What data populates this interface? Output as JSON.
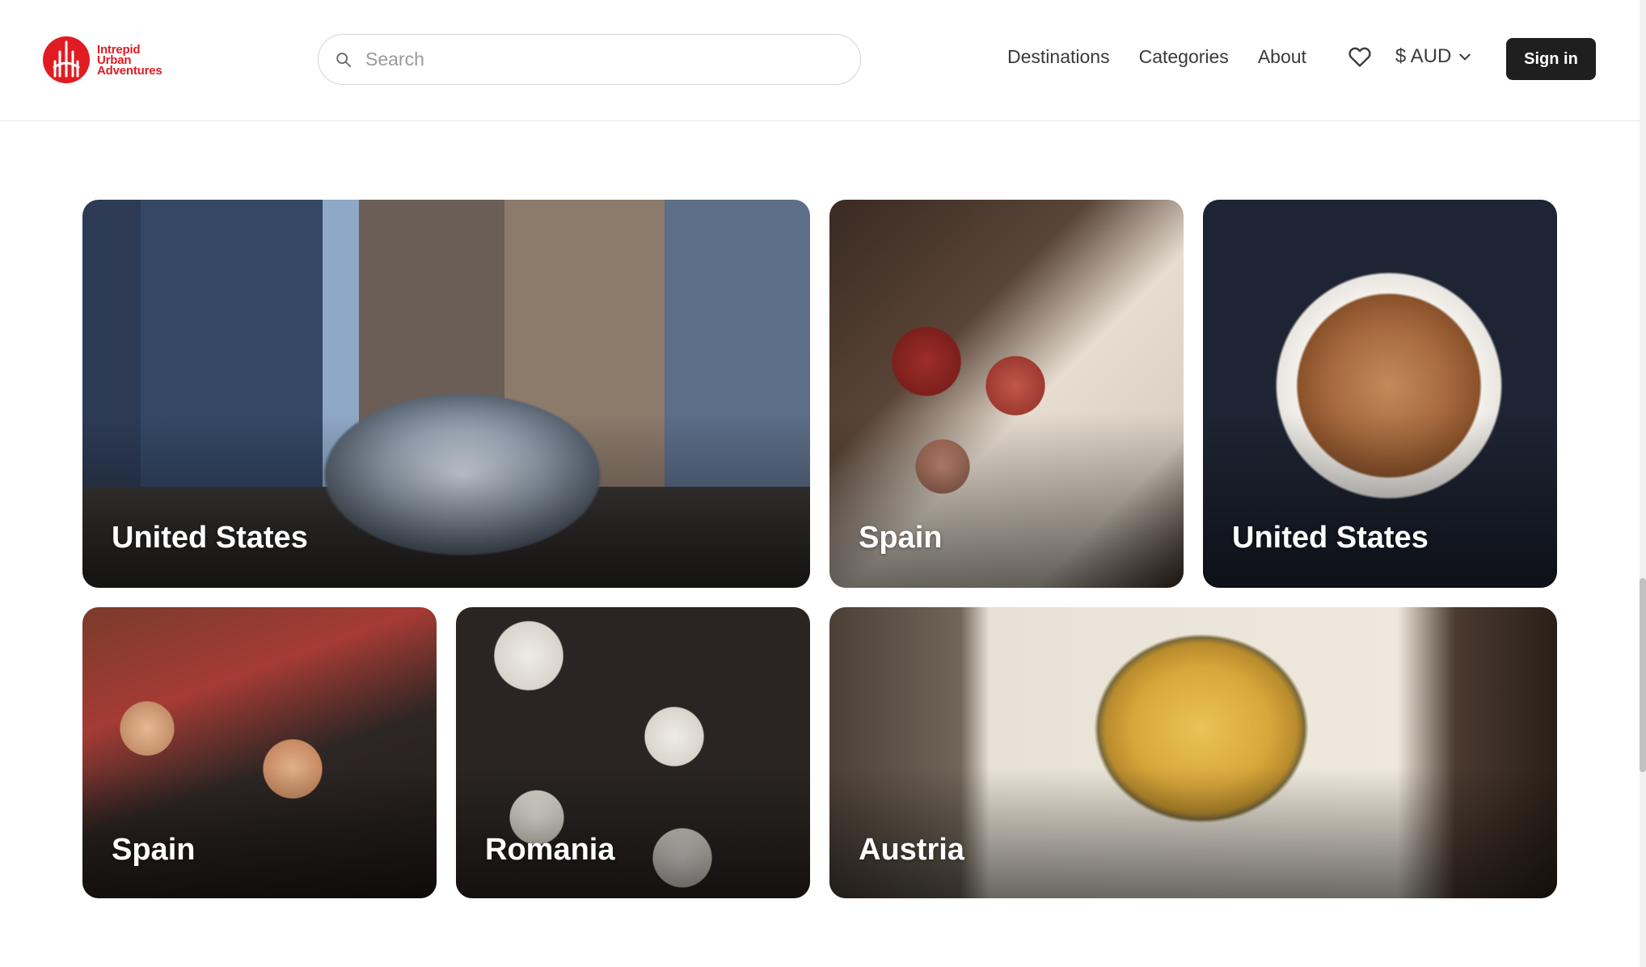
{
  "brand": {
    "line1": "Intrepid",
    "line2": "Urban",
    "line3": "Adventures",
    "color": "#e11b22"
  },
  "search": {
    "placeholder": "Search",
    "value": ""
  },
  "nav": {
    "items": [
      "Destinations",
      "Categories",
      "About"
    ],
    "currency": "$ AUD",
    "signin_label": "Sign in"
  },
  "cards": [
    {
      "label": "United States",
      "image": "cloud-gate-chicago"
    },
    {
      "label": "Spain",
      "image": "cured-meats-platter"
    },
    {
      "label": "United States",
      "image": "latte-art-coffee"
    },
    {
      "label": "Spain",
      "image": "group-toasting-drinks"
    },
    {
      "label": "Romania",
      "image": "table-of-dishes"
    },
    {
      "label": "Austria",
      "image": "kaiserschmarrn-pan"
    }
  ],
  "colors": {
    "signin_bg": "#1f1f1f",
    "nav_text": "#3a3a3a"
  }
}
